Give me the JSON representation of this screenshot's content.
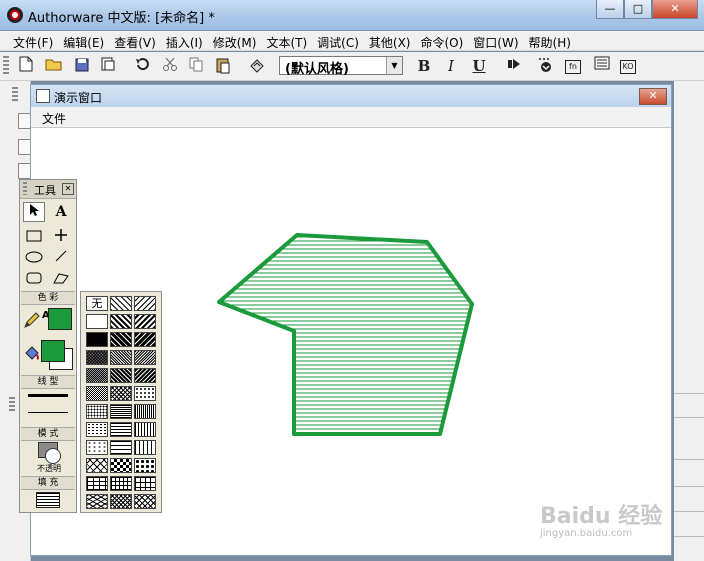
{
  "window": {
    "title": "Authorware 中文版: [未命名] *",
    "min": "—",
    "max": "□",
    "close": "✕"
  },
  "menu": [
    "文件(F)",
    "编辑(E)",
    "查看(V)",
    "插入(I)",
    "修改(M)",
    "文本(T)",
    "调试(C)",
    "其他(X)",
    "命令(O)",
    "窗口(W)",
    "帮助(H)"
  ],
  "toolbar": {
    "style_value": "(默认风格)",
    "bold": "B",
    "italic": "I",
    "underline": "U",
    "fn": "fn",
    "ko": "KO"
  },
  "presentation": {
    "title": "演示窗口",
    "close": "✕",
    "menu": "文件"
  },
  "tools": {
    "title": "工具",
    "text_tool": "A",
    "color_label": "色 彩",
    "line_label": "线 型",
    "mode_label": "模 式",
    "mode_value": "不透明",
    "fill_label": "填 充",
    "line_color": "#000000",
    "fill_foreground": "#1a9a3a",
    "fill_background": "#ffffff"
  },
  "patterns": {
    "none": "无"
  },
  "shape": {
    "stroke_color": "#1a9a3a",
    "stroke_width": 4,
    "fill_pattern": "horizontal-lines"
  },
  "watermark": {
    "logo": "Baidu 经验",
    "url": "jingyan.baidu.com"
  }
}
